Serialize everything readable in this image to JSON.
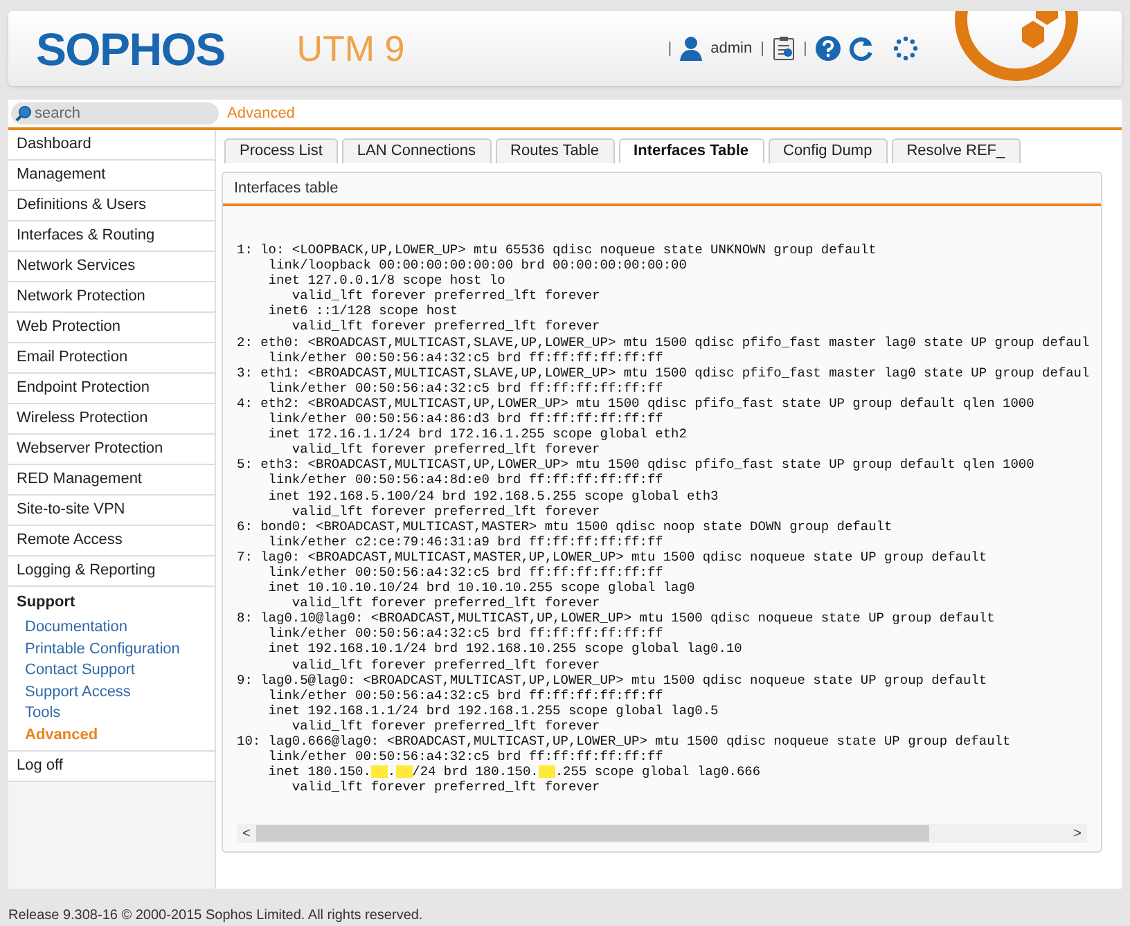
{
  "header": {
    "logo": "SOPHOS",
    "product": "UTM 9",
    "user": "admin",
    "separators": [
      "|",
      "|",
      "|"
    ]
  },
  "search": {
    "placeholder": "search"
  },
  "breadcrumb": "Advanced",
  "sidebar": {
    "items": [
      {
        "label": "Dashboard",
        "selected": false
      },
      {
        "label": "Management",
        "selected": false
      },
      {
        "label": "Definitions & Users",
        "selected": false
      },
      {
        "label": "Interfaces & Routing",
        "selected": false
      },
      {
        "label": "Network Services",
        "selected": false
      },
      {
        "label": "Network Protection",
        "selected": false
      },
      {
        "label": "Web Protection",
        "selected": false
      },
      {
        "label": "Email Protection",
        "selected": false
      },
      {
        "label": "Endpoint Protection",
        "selected": false
      },
      {
        "label": "Wireless Protection",
        "selected": false
      },
      {
        "label": "Webserver Protection",
        "selected": false
      },
      {
        "label": "RED Management",
        "selected": false
      },
      {
        "label": "Site-to-site VPN",
        "selected": false
      },
      {
        "label": "Remote Access",
        "selected": false
      },
      {
        "label": "Logging & Reporting",
        "selected": false
      },
      {
        "label": "Support",
        "selected": false,
        "expanded": true,
        "children": [
          {
            "label": "Documentation",
            "selected": false
          },
          {
            "label": "Printable Configuration",
            "selected": false
          },
          {
            "label": "Contact Support",
            "selected": false
          },
          {
            "label": "Support Access",
            "selected": false
          },
          {
            "label": "Tools",
            "selected": false
          },
          {
            "label": "Advanced",
            "selected": true
          }
        ]
      },
      {
        "label": "Log off",
        "selected": false
      }
    ]
  },
  "tabs": [
    {
      "label": "Process List",
      "selected": false
    },
    {
      "label": "LAN Connections",
      "selected": false
    },
    {
      "label": "Routes Table",
      "selected": false
    },
    {
      "label": "Interfaces Table",
      "selected": true
    },
    {
      "label": "Config Dump",
      "selected": false
    },
    {
      "label": "Resolve REF_",
      "selected": false
    }
  ],
  "panel": {
    "title": "Interfaces table",
    "output_lines": [
      {
        "text": "1: lo: <LOOPBACK,UP,LOWER_UP> mtu 65536 qdisc noqueue state UNKNOWN group default"
      },
      {
        "text": "    link/loopback 00:00:00:00:00:00 brd 00:00:00:00:00:00"
      },
      {
        "text": "    inet 127.0.0.1/8 scope host lo"
      },
      {
        "text": "       valid_lft forever preferred_lft forever"
      },
      {
        "text": "    inet6 ::1/128 scope host"
      },
      {
        "text": "       valid_lft forever preferred_lft forever"
      },
      {
        "text": "2: eth0: <BROADCAST,MULTICAST,SLAVE,UP,LOWER_UP> mtu 1500 qdisc pfifo_fast master lag0 state UP group defaul"
      },
      {
        "text": "    link/ether 00:50:56:a4:32:c5 brd ff:ff:ff:ff:ff:ff"
      },
      {
        "text": "3: eth1: <BROADCAST,MULTICAST,SLAVE,UP,LOWER_UP> mtu 1500 qdisc pfifo_fast master lag0 state UP group defaul"
      },
      {
        "text": "    link/ether 00:50:56:a4:32:c5 brd ff:ff:ff:ff:ff:ff"
      },
      {
        "text": "4: eth2: <BROADCAST,MULTICAST,UP,LOWER_UP> mtu 1500 qdisc pfifo_fast state UP group default qlen 1000"
      },
      {
        "text": "    link/ether 00:50:56:a4:86:d3 brd ff:ff:ff:ff:ff:ff"
      },
      {
        "text": "    inet 172.16.1.1/24 brd 172.16.1.255 scope global eth2"
      },
      {
        "text": "       valid_lft forever preferred_lft forever"
      },
      {
        "text": "5: eth3: <BROADCAST,MULTICAST,UP,LOWER_UP> mtu 1500 qdisc pfifo_fast state UP group default qlen 1000"
      },
      {
        "text": "    link/ether 00:50:56:a4:8d:e0 brd ff:ff:ff:ff:ff:ff"
      },
      {
        "text": "    inet 192.168.5.100/24 brd 192.168.5.255 scope global eth3"
      },
      {
        "text": "       valid_lft forever preferred_lft forever"
      },
      {
        "text": "6: bond0: <BROADCAST,MULTICAST,MASTER> mtu 1500 qdisc noop state DOWN group default"
      },
      {
        "text": "    link/ether c2:ce:79:46:31:a9 brd ff:ff:ff:ff:ff:ff"
      },
      {
        "text": "7: lag0: <BROADCAST,MULTICAST,MASTER,UP,LOWER_UP> mtu 1500 qdisc noqueue state UP group default"
      },
      {
        "text": "    link/ether 00:50:56:a4:32:c5 brd ff:ff:ff:ff:ff:ff"
      },
      {
        "text": "    inet 10.10.10.10/24 brd 10.10.10.255 scope global lag0"
      },
      {
        "text": "       valid_lft forever preferred_lft forever"
      },
      {
        "text": "8: lag0.10@lag0: <BROADCAST,MULTICAST,UP,LOWER_UP> mtu 1500 qdisc noqueue state UP group default"
      },
      {
        "text": "    link/ether 00:50:56:a4:32:c5 brd ff:ff:ff:ff:ff:ff"
      },
      {
        "text": "    inet 192.168.10.1/24 brd 192.168.10.255 scope global lag0.10"
      },
      {
        "text": "       valid_lft forever preferred_lft forever"
      },
      {
        "text": "9: lag0.5@lag0: <BROADCAST,MULTICAST,UP,LOWER_UP> mtu 1500 qdisc noqueue state UP group default"
      },
      {
        "text": "    link/ether 00:50:56:a4:32:c5 brd ff:ff:ff:ff:ff:ff"
      },
      {
        "text": "    inet 192.168.1.1/24 brd 192.168.1.255 scope global lag0.5"
      },
      {
        "text": "       valid_lft forever preferred_lft forever"
      },
      {
        "text": "10: lag0.666@lag0: <BROADCAST,MULTICAST,UP,LOWER_UP> mtu 1500 qdisc noqueue state UP group default"
      },
      {
        "text": "    link/ether 00:50:56:a4:32:c5 brd ff:ff:ff:ff:ff:ff"
      },
      {
        "parts": [
          {
            "text": "    inet 180.150."
          },
          {
            "redacted": true
          },
          {
            "text": "."
          },
          {
            "redacted": true
          },
          {
            "text": "/24 brd 180.150."
          },
          {
            "redacted": true
          },
          {
            "text": ".255 scope global lag0.666"
          }
        ]
      },
      {
        "text": "       valid_lft forever preferred_lft forever"
      }
    ],
    "scroll_left": "<",
    "scroll_right": ">"
  },
  "footer": "Release 9.308-16  © 2000-2015 Sophos Limited. All rights reserved."
}
